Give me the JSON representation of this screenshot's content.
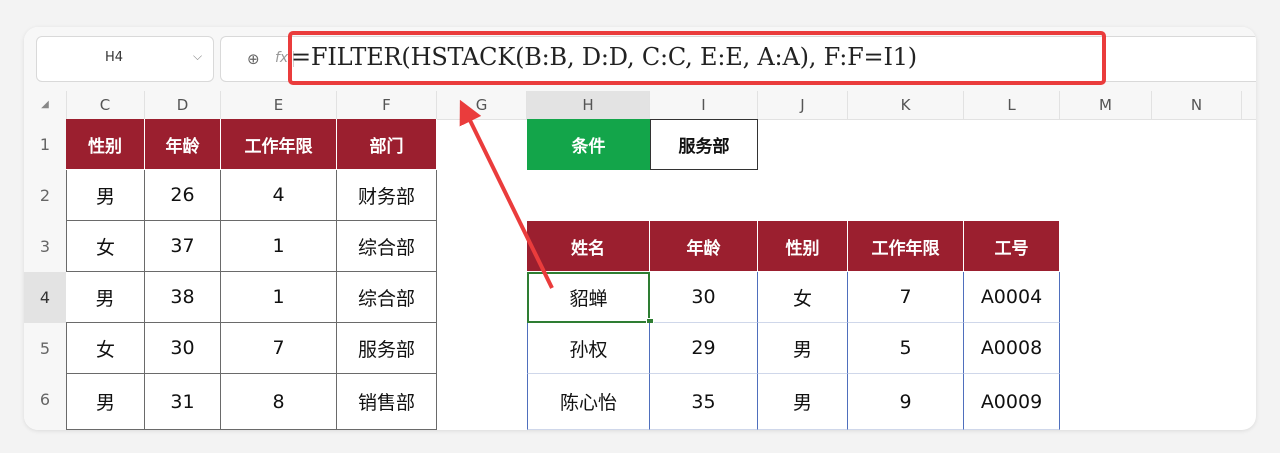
{
  "namebox": {
    "cell_ref": "H4",
    "chevron": "⌵"
  },
  "formula_bar": {
    "zoom_icon": "⊕",
    "fx_label": "fx",
    "formula": "=FILTER(HSTACK(B:B, D:D, C:C, E:E, A:A), F:F=I1)"
  },
  "columns": [
    "C",
    "D",
    "E",
    "F",
    "G",
    "H",
    "I",
    "J",
    "K",
    "L",
    "M",
    "N"
  ],
  "active_column": "H",
  "rows": [
    "1",
    "2",
    "3",
    "4",
    "5",
    "6"
  ],
  "active_row": "4",
  "left_table": {
    "headers": [
      "性别",
      "年龄",
      "工作年限",
      "部门"
    ],
    "rows": [
      [
        "男",
        "26",
        "4",
        "财务部"
      ],
      [
        "女",
        "37",
        "1",
        "综合部"
      ],
      [
        "男",
        "38",
        "1",
        "综合部"
      ],
      [
        "女",
        "30",
        "7",
        "服务部"
      ],
      [
        "男",
        "31",
        "8",
        "销售部"
      ]
    ]
  },
  "condition": {
    "label": "条件",
    "value": "服务部"
  },
  "result_table": {
    "headers": [
      "姓名",
      "年龄",
      "性别",
      "工作年限",
      "工号"
    ],
    "rows": [
      [
        "貂蝉",
        "30",
        "女",
        "7",
        "A0004"
      ],
      [
        "孙权",
        "29",
        "男",
        "5",
        "A0008"
      ],
      [
        "陈心怡",
        "35",
        "男",
        "9",
        "A0009"
      ]
    ]
  },
  "colors": {
    "header_red": "#9b1f2f",
    "condition_green": "#13a54a",
    "highlight_red": "#ea3c3c",
    "selection_green": "#2e7d32"
  }
}
